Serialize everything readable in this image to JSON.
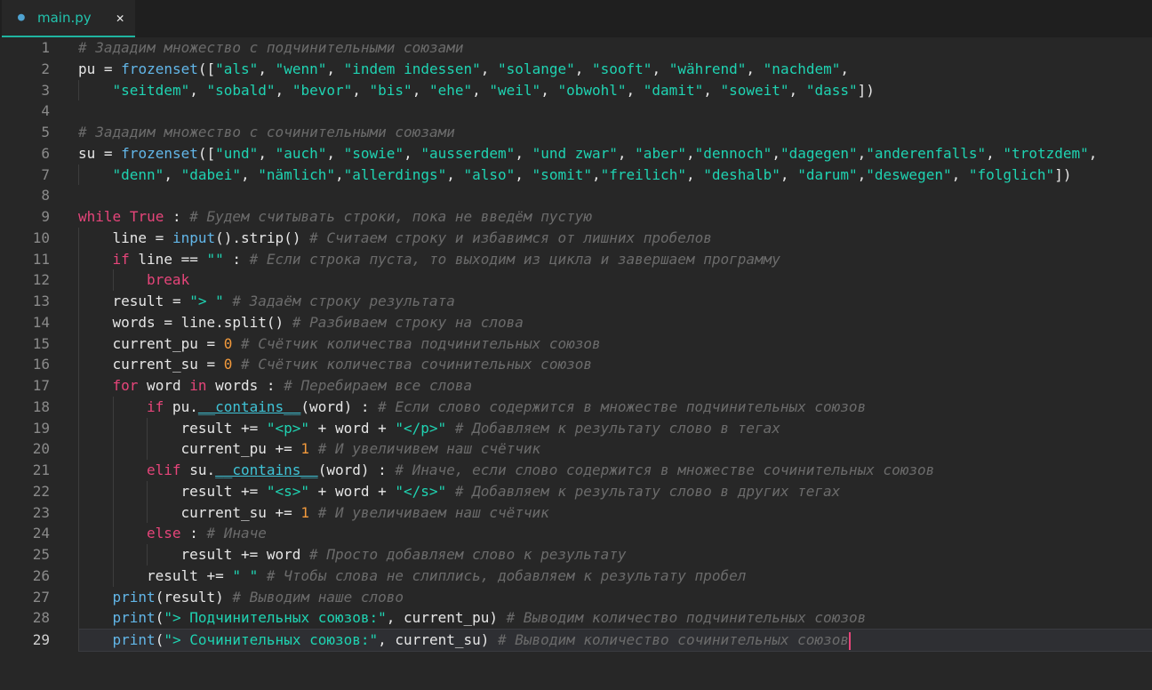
{
  "tab": {
    "filename": "main.py",
    "icon": "python-icon",
    "close": "✕"
  },
  "colors": {
    "keyword": "#e6457a",
    "builtin": "#62b6e8",
    "string": "#1fd3b2",
    "number": "#f39a3c",
    "comment": "#6b6b6b",
    "accent": "#1fb5a0"
  },
  "current_line": 29,
  "lines": [
    {
      "n": "1",
      "indent": 0,
      "tokens": [
        [
          "c",
          "# Зададим множество с подчинительными союзами"
        ]
      ]
    },
    {
      "n": "2",
      "indent": 0,
      "tokens": [
        [
          "t",
          "pu = "
        ],
        [
          "f",
          "frozenset"
        ],
        [
          "t",
          "(["
        ],
        [
          "s",
          "\"als\""
        ],
        [
          "t",
          ", "
        ],
        [
          "s",
          "\"wenn\""
        ],
        [
          "t",
          ", "
        ],
        [
          "s",
          "\"indem indessen\""
        ],
        [
          "t",
          ", "
        ],
        [
          "s",
          "\"solange\""
        ],
        [
          "t",
          ", "
        ],
        [
          "s",
          "\"sooft\""
        ],
        [
          "t",
          ", "
        ],
        [
          "s",
          "\"während\""
        ],
        [
          "t",
          ", "
        ],
        [
          "s",
          "\"nachdem\""
        ],
        [
          "t",
          ","
        ]
      ]
    },
    {
      "n": "3",
      "indent": 1,
      "tokens": [
        [
          "s",
          "\"seitdem\""
        ],
        [
          "t",
          ", "
        ],
        [
          "s",
          "\"sobald\""
        ],
        [
          "t",
          ", "
        ],
        [
          "s",
          "\"bevor\""
        ],
        [
          "t",
          ", "
        ],
        [
          "s",
          "\"bis\""
        ],
        [
          "t",
          ", "
        ],
        [
          "s",
          "\"ehe\""
        ],
        [
          "t",
          ", "
        ],
        [
          "s",
          "\"weil\""
        ],
        [
          "t",
          ", "
        ],
        [
          "s",
          "\"obwohl\""
        ],
        [
          "t",
          ", "
        ],
        [
          "s",
          "\"damit\""
        ],
        [
          "t",
          ", "
        ],
        [
          "s",
          "\"soweit\""
        ],
        [
          "t",
          ", "
        ],
        [
          "s",
          "\"dass\""
        ],
        [
          "t",
          "])"
        ]
      ]
    },
    {
      "n": "4",
      "indent": 0,
      "tokens": []
    },
    {
      "n": "5",
      "indent": 0,
      "tokens": [
        [
          "c",
          "# Зададим множество с сочинительными союзами"
        ]
      ]
    },
    {
      "n": "6",
      "indent": 0,
      "tokens": [
        [
          "t",
          "su = "
        ],
        [
          "f",
          "frozenset"
        ],
        [
          "t",
          "(["
        ],
        [
          "s",
          "\"und\""
        ],
        [
          "t",
          ", "
        ],
        [
          "s",
          "\"auch\""
        ],
        [
          "t",
          ", "
        ],
        [
          "s",
          "\"sowie\""
        ],
        [
          "t",
          ", "
        ],
        [
          "s",
          "\"ausserdem\""
        ],
        [
          "t",
          ", "
        ],
        [
          "s",
          "\"und zwar\""
        ],
        [
          "t",
          ", "
        ],
        [
          "s",
          "\"aber\""
        ],
        [
          "t",
          ","
        ],
        [
          "s",
          "\"dennoch\""
        ],
        [
          "t",
          ","
        ],
        [
          "s",
          "\"dagegen\""
        ],
        [
          "t",
          ","
        ],
        [
          "s",
          "\"anderenfalls\""
        ],
        [
          "t",
          ", "
        ],
        [
          "s",
          "\"trotzdem\""
        ],
        [
          "t",
          ","
        ]
      ]
    },
    {
      "n": "7",
      "indent": 1,
      "tokens": [
        [
          "s",
          "\"denn\""
        ],
        [
          "t",
          ", "
        ],
        [
          "s",
          "\"dabei\""
        ],
        [
          "t",
          ", "
        ],
        [
          "s",
          "\"nämlich\""
        ],
        [
          "t",
          ","
        ],
        [
          "s",
          "\"allerdings\""
        ],
        [
          "t",
          ", "
        ],
        [
          "s",
          "\"also\""
        ],
        [
          "t",
          ", "
        ],
        [
          "s",
          "\"somit\""
        ],
        [
          "t",
          ","
        ],
        [
          "s",
          "\"freilich\""
        ],
        [
          "t",
          ", "
        ],
        [
          "s",
          "\"deshalb\""
        ],
        [
          "t",
          ", "
        ],
        [
          "s",
          "\"darum\""
        ],
        [
          "t",
          ","
        ],
        [
          "s",
          "\"deswegen\""
        ],
        [
          "t",
          ", "
        ],
        [
          "s",
          "\"folglich\""
        ],
        [
          "t",
          "])"
        ]
      ]
    },
    {
      "n": "8",
      "indent": 0,
      "tokens": []
    },
    {
      "n": "9",
      "indent": 0,
      "tokens": [
        [
          "k",
          "while"
        ],
        [
          "t",
          " "
        ],
        [
          "k",
          "True"
        ],
        [
          "t",
          " : "
        ],
        [
          "c",
          "# Будем считывать строки, пока не введём пустую"
        ]
      ]
    },
    {
      "n": "10",
      "indent": 1,
      "tokens": [
        [
          "t",
          "line = "
        ],
        [
          "f",
          "input"
        ],
        [
          "t",
          "().strip() "
        ],
        [
          "c",
          "# Считаем строку и избавимся от лишних пробелов"
        ]
      ]
    },
    {
      "n": "11",
      "indent": 1,
      "tokens": [
        [
          "k",
          "if"
        ],
        [
          "t",
          " line == "
        ],
        [
          "s",
          "\"\""
        ],
        [
          "t",
          " : "
        ],
        [
          "c",
          "# Если строка пуста, то выходим из цикла и завершаем программу"
        ]
      ]
    },
    {
      "n": "12",
      "indent": 2,
      "tokens": [
        [
          "k",
          "break"
        ]
      ]
    },
    {
      "n": "13",
      "indent": 1,
      "tokens": [
        [
          "t",
          "result = "
        ],
        [
          "s",
          "\"> \""
        ],
        [
          "t",
          " "
        ],
        [
          "c",
          "# Задаём строку результата"
        ]
      ]
    },
    {
      "n": "14",
      "indent": 1,
      "tokens": [
        [
          "t",
          "words = line.split() "
        ],
        [
          "c",
          "# Разбиваем строку на слова"
        ]
      ]
    },
    {
      "n": "15",
      "indent": 1,
      "tokens": [
        [
          "t",
          "current_pu = "
        ],
        [
          "n",
          "0"
        ],
        [
          "t",
          " "
        ],
        [
          "c",
          "# Счётчик количества подчинительных союзов"
        ]
      ]
    },
    {
      "n": "16",
      "indent": 1,
      "tokens": [
        [
          "t",
          "current_su = "
        ],
        [
          "n",
          "0"
        ],
        [
          "t",
          " "
        ],
        [
          "c",
          "# Счётчик количества сочинительных союзов"
        ]
      ]
    },
    {
      "n": "17",
      "indent": 1,
      "tokens": [
        [
          "k",
          "for"
        ],
        [
          "t",
          " word "
        ],
        [
          "k",
          "in"
        ],
        [
          "t",
          " words : "
        ],
        [
          "c",
          "# Перебираем все слова"
        ]
      ]
    },
    {
      "n": "18",
      "indent": 2,
      "tokens": [
        [
          "k",
          "if"
        ],
        [
          "t",
          " pu."
        ],
        [
          "m",
          "__contains__"
        ],
        [
          "t",
          "(word) : "
        ],
        [
          "c",
          "# Если слово содержится в множестве подчинительных союзов"
        ]
      ]
    },
    {
      "n": "19",
      "indent": 3,
      "tokens": [
        [
          "t",
          "result += "
        ],
        [
          "s",
          "\"<p>\""
        ],
        [
          "t",
          " + word + "
        ],
        [
          "s",
          "\"</p>\""
        ],
        [
          "t",
          " "
        ],
        [
          "c",
          "# Добавляем к результату слово в тегах"
        ]
      ]
    },
    {
      "n": "20",
      "indent": 3,
      "tokens": [
        [
          "t",
          "current_pu += "
        ],
        [
          "n",
          "1"
        ],
        [
          "t",
          " "
        ],
        [
          "c",
          "# И увеличивем наш счётчик"
        ]
      ]
    },
    {
      "n": "21",
      "indent": 2,
      "tokens": [
        [
          "k",
          "elif"
        ],
        [
          "t",
          " su."
        ],
        [
          "m",
          "__contains__"
        ],
        [
          "t",
          "(word) : "
        ],
        [
          "c",
          "# Иначе, если слово содержится в множестве сочинительных союзов"
        ]
      ]
    },
    {
      "n": "22",
      "indent": 3,
      "tokens": [
        [
          "t",
          "result += "
        ],
        [
          "s",
          "\"<s>\""
        ],
        [
          "t",
          " + word + "
        ],
        [
          "s",
          "\"</s>\""
        ],
        [
          "t",
          " "
        ],
        [
          "c",
          "# Добавляем к результату слово в других тегах"
        ]
      ]
    },
    {
      "n": "23",
      "indent": 3,
      "tokens": [
        [
          "t",
          "current_su += "
        ],
        [
          "n",
          "1"
        ],
        [
          "t",
          " "
        ],
        [
          "c",
          "# И увеличиваем наш счётчик"
        ]
      ]
    },
    {
      "n": "24",
      "indent": 2,
      "tokens": [
        [
          "k",
          "else"
        ],
        [
          "t",
          " : "
        ],
        [
          "c",
          "# Иначе"
        ]
      ]
    },
    {
      "n": "25",
      "indent": 3,
      "tokens": [
        [
          "t",
          "result += word "
        ],
        [
          "c",
          "# Просто добавляем слово к результату"
        ]
      ]
    },
    {
      "n": "26",
      "indent": 2,
      "tokens": [
        [
          "t",
          "result += "
        ],
        [
          "s",
          "\" \""
        ],
        [
          "t",
          " "
        ],
        [
          "c",
          "# Чтобы слова не слиплись, добавляем к результату пробел"
        ]
      ]
    },
    {
      "n": "27",
      "indent": 1,
      "tokens": [
        [
          "f",
          "print"
        ],
        [
          "t",
          "(result) "
        ],
        [
          "c",
          "# Выводим наше слово"
        ]
      ]
    },
    {
      "n": "28",
      "indent": 1,
      "tokens": [
        [
          "f",
          "print"
        ],
        [
          "t",
          "("
        ],
        [
          "s",
          "\"> Подчинительных союзов:\""
        ],
        [
          "t",
          ", current_pu) "
        ],
        [
          "c",
          "# Выводим количество подчинительных союзов"
        ]
      ]
    },
    {
      "n": "29",
      "indent": 1,
      "tokens": [
        [
          "f",
          "print"
        ],
        [
          "t",
          "("
        ],
        [
          "s",
          "\"> Сочинительных союзов:\""
        ],
        [
          "t",
          ", current_su) "
        ],
        [
          "c",
          "# Выводим количество сочинительных союзов"
        ]
      ]
    }
  ]
}
